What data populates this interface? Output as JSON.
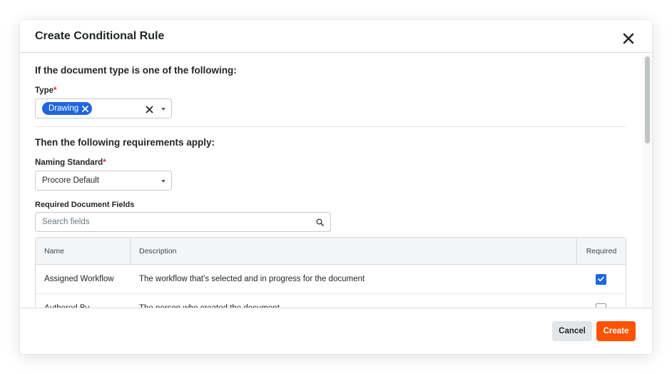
{
  "modal": {
    "title": "Create Conditional Rule",
    "close_icon": "close-icon"
  },
  "condition": {
    "heading": "If the document type is one of the following:",
    "type_label": "Type",
    "required_marker": "*",
    "selected_chips": [
      "Drawing"
    ]
  },
  "requirements": {
    "heading": "Then the following requirements apply:",
    "naming_label": "Naming Standard",
    "naming_value": "Procore Default",
    "fields_label": "Required Document Fields",
    "search_placeholder": "Search fields"
  },
  "table": {
    "columns": [
      "Name",
      "Description",
      "Required"
    ],
    "rows": [
      {
        "name": "Assigned Workflow",
        "description": "The workflow that's selected and in progress for the document",
        "required": true
      },
      {
        "name": "Authored By",
        "description": "The person who created the document",
        "required": false
      }
    ]
  },
  "footer": {
    "cancel_label": "Cancel",
    "create_label": "Create"
  },
  "colors": {
    "primary_blue": "#2066df",
    "create_orange": "#ff5200",
    "required_red": "#d92b2b"
  }
}
